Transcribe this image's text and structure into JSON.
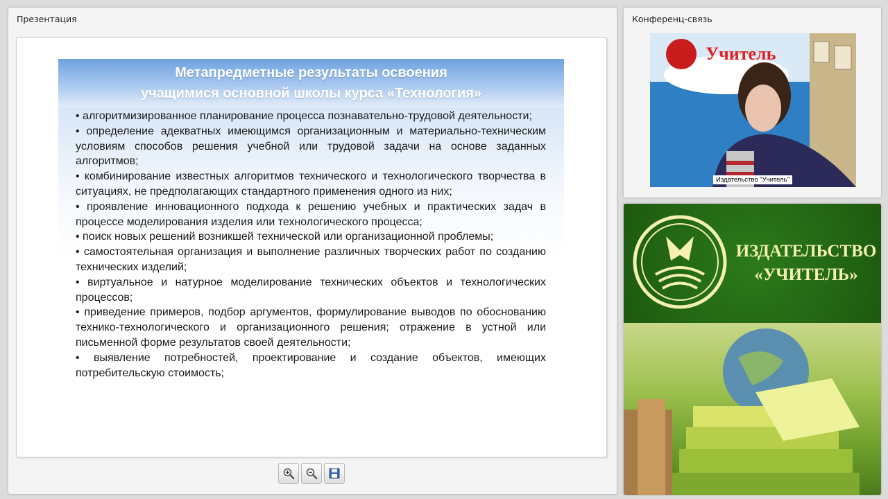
{
  "presentation_panel": {
    "title": "Презентация"
  },
  "conference_panel": {
    "title": "Конференц-связь",
    "video_caption": "Издательство \"Учитель\""
  },
  "slide": {
    "title_line1": "Метапредметные результаты  освоения",
    "title_line2": "учащимися основной школы курса «Технология»",
    "bullets": [
      "•   алгоритмизированное   планирование   процесса   познавательно-трудовой деятельности;",
      "•  определение  адекватных  имеющимся  организационным  и  материально-техническим условиям способов решения учебной или трудовой задачи на основе заданных алгоритмов;",
      "•  комбинирование  известных  алгоритмов  технического  и  технологического творчества в ситуациях, не предполагающих стандартного применения одного из них;",
      "•  проявление  инновационного  подхода  к  решению  учебных  и  практических задач в процессе моделирования изделия или технологического процесса;",
      "•   поиск   новых   решений   возникшей   технической   или   организационной проблемы;",
      "•  самостоятельная организация и выполнение различных творческих работ по созданию технических изделий;",
      "•    виртуальное    и    натурное    моделирование    технических    объектов    и технологических процессов;",
      "•  приведение  примеров,  подбор  аргументов,  формулирование  выводов  по обоснованию   технико-технологического   и   организационного   решения; отражение в устной или письменной форме результатов своей деятельности;",
      "•  выявление  потребностей,  проектирование  и  создание  объектов,  имеющих потребительскую стоимость;"
    ]
  },
  "banner": {
    "line1": "ИЗДАТЕЛЬСТВО",
    "line2": "«УЧИТЕЛЬ»"
  },
  "toolbar": {
    "zoom_in_icon": "zoom-in-icon",
    "zoom_out_icon": "zoom-out-icon",
    "save_icon": "save-icon"
  },
  "colors": {
    "banner_green": "#1f5f12",
    "banner_text": "#f3f0b0",
    "slide_header_blue": "#6ea2e0"
  }
}
